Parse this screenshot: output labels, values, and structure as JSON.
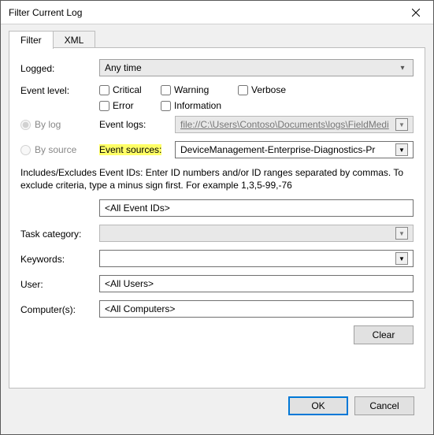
{
  "window": {
    "title": "Filter Current Log",
    "close_icon": "close-icon"
  },
  "tabs": {
    "filter": "Filter",
    "xml": "XML"
  },
  "labels": {
    "logged": "Logged:",
    "event_level": "Event level:",
    "by_log": "By log",
    "by_source": "By source",
    "event_logs": "Event logs:",
    "event_sources": "Event sources:",
    "includes": "Includes/Excludes Event IDs: Enter ID numbers and/or ID ranges separated by commas. To exclude criteria, type a minus sign first. For example 1,3,5-99,-76",
    "task_category": "Task category:",
    "keywords": "Keywords:",
    "user": "User:",
    "computers": "Computer(s):"
  },
  "fields": {
    "logged_value": "Any time",
    "event_logs_value": "file://C:\\Users\\Contoso\\Documents\\logs\\FieldMedi",
    "event_sources_value": "DeviceManagement-Enterprise-Diagnostics-Pr",
    "event_ids_placeholder": "<All Event IDs>",
    "user_placeholder": "<All Users>",
    "computers_placeholder": "<All Computers>"
  },
  "checks": {
    "critical": "Critical",
    "warning": "Warning",
    "verbose": "Verbose",
    "error": "Error",
    "information": "Information"
  },
  "buttons": {
    "clear": "Clear",
    "ok": "OK",
    "cancel": "Cancel"
  }
}
